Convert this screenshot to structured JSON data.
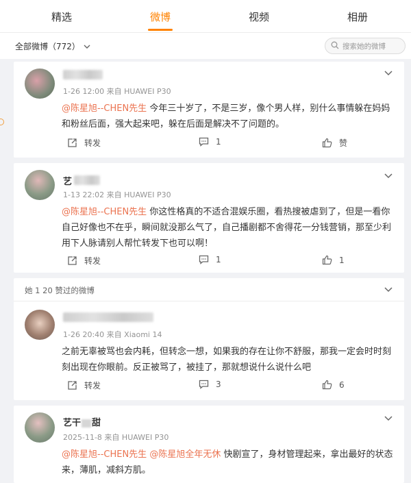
{
  "tabs": [
    {
      "label": "精选"
    },
    {
      "label": "微博"
    },
    {
      "label": "视频"
    },
    {
      "label": "相册"
    }
  ],
  "colors": {
    "accent": "#ff8200",
    "mention": "#eb7350"
  },
  "filter": {
    "label": "全部微博（772）",
    "search_placeholder": "搜索她的微博"
  },
  "posts": [
    {
      "username": "",
      "meta": "1-26 12:00 来自 HUAWEI P30",
      "mention": "@陈星旭--CHEN先生",
      "text": " 今年三十岁了，不是三岁，像个男人样，别什么事情躲在妈妈和粉丝后面，强大起来吧，躲在后面是解决不了问题的。",
      "repost_label": "转发",
      "comment_count": "1",
      "like_label": "赞"
    },
    {
      "username": "艺",
      "meta": "1-13 22:02 来自 HUAWEI P30",
      "mention": "@陈星旭--CHEN先生",
      "text": " 你这性格真的不适合混娱乐圈，看热搜被虐到了，但是一看你自己好像也不在乎，瞬间就没那么气了，自己播剧都不舍得花一分钱营销，那至少利用下人脉请别人帮忙转发下也可以啊！",
      "repost_label": "转发",
      "comment_count": "1",
      "like_count": "1"
    },
    {
      "header": "她 1 20 赞过的微博",
      "username": "",
      "meta": "1-26 20:40 来自 Xiaomi 14",
      "text": "之前无辜被骂也会内耗，但转念一想，如果我的存在让你不舒服，那我一定会时时刻刻出现在你眼前。反正被骂了，被挂了，那就想说什么说什么吧",
      "repost_label": "转发",
      "comment_count": "3",
      "like_count": "6"
    },
    {
      "username_prefix": "艺干",
      "username_suffix": "甜",
      "meta": "2025-11-8 来自 HUAWEI P30",
      "mention": "@陈星旭--CHEN先生",
      "mention2": "@陈星旭全年无休",
      "text": " 快剧宣了，身材管理起来，拿出最好的状态来，薄肌，减斜方肌。"
    }
  ]
}
